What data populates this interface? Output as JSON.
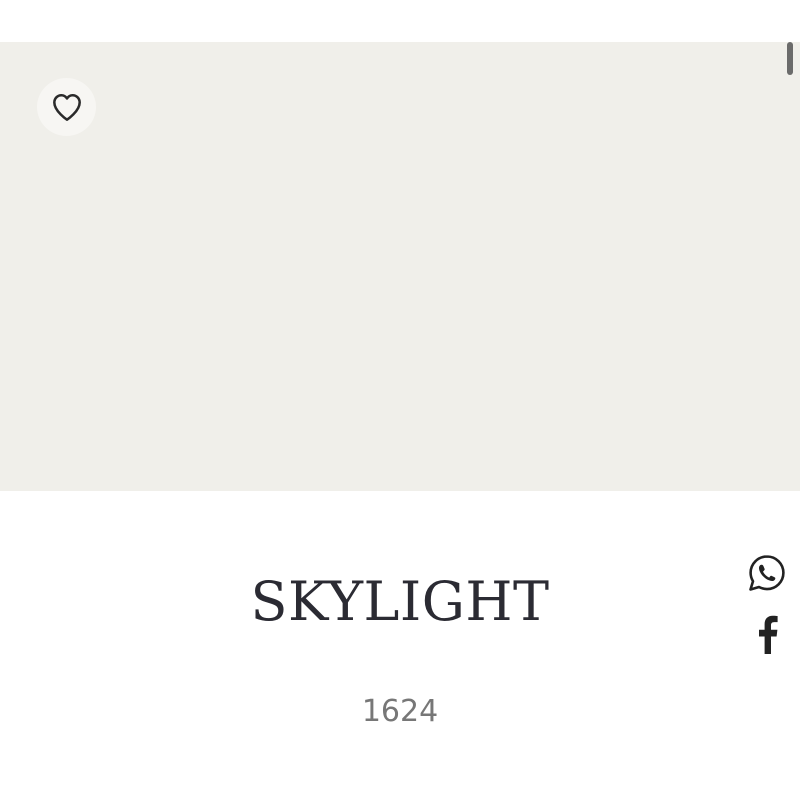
{
  "swatch": {
    "color": "#f0efea"
  },
  "favorite": {
    "icon": "heart-icon"
  },
  "product": {
    "name": "SKYLIGHT",
    "code": "1624"
  },
  "share": {
    "whatsapp_icon": "whatsapp-icon",
    "facebook_icon": "facebook-icon"
  },
  "colors": {
    "title": "#2b2b33",
    "code": "#777777",
    "icons": "#222222"
  }
}
